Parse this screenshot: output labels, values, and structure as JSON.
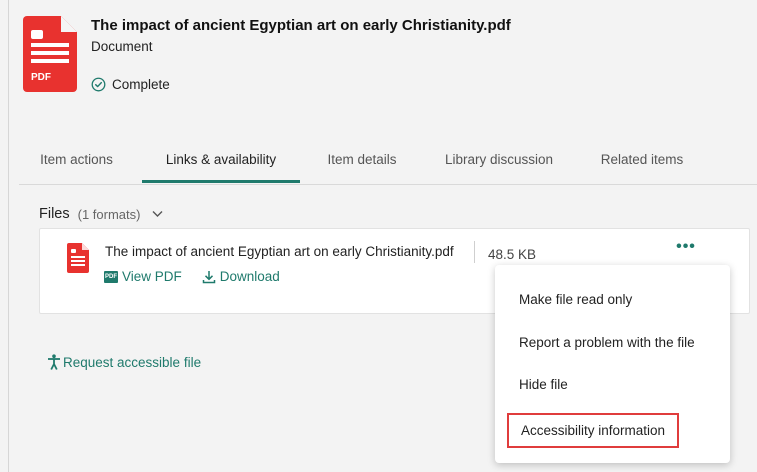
{
  "document": {
    "title": "The impact of ancient Egyptian art on early Christianity.pdf",
    "type": "Document",
    "status": "Complete",
    "icon": "pdf-icon",
    "icon_label": "PDF"
  },
  "tabs": [
    {
      "label": "Item actions"
    },
    {
      "label": "Links & availability",
      "active": true
    },
    {
      "label": "Item details"
    },
    {
      "label": "Library discussion"
    },
    {
      "label": "Related items"
    }
  ],
  "files": {
    "heading": "Files",
    "count": "(1 formats)",
    "items": [
      {
        "name": "The impact of ancient Egyptian art on early Christianity.pdf",
        "size": "48.5 KB",
        "view_label": "View PDF",
        "download_label": "Download"
      }
    ]
  },
  "request_label": "Request accessible file",
  "menu": {
    "items": [
      {
        "label": "Make file read only"
      },
      {
        "label": "Report a problem with the file"
      },
      {
        "label": "Hide file"
      },
      {
        "label": "Accessibility information",
        "highlighted": true
      }
    ]
  },
  "colors": {
    "accent": "#1f7a6c",
    "pdf_red": "#e8322f",
    "highlight_border": "#e03c3c"
  }
}
